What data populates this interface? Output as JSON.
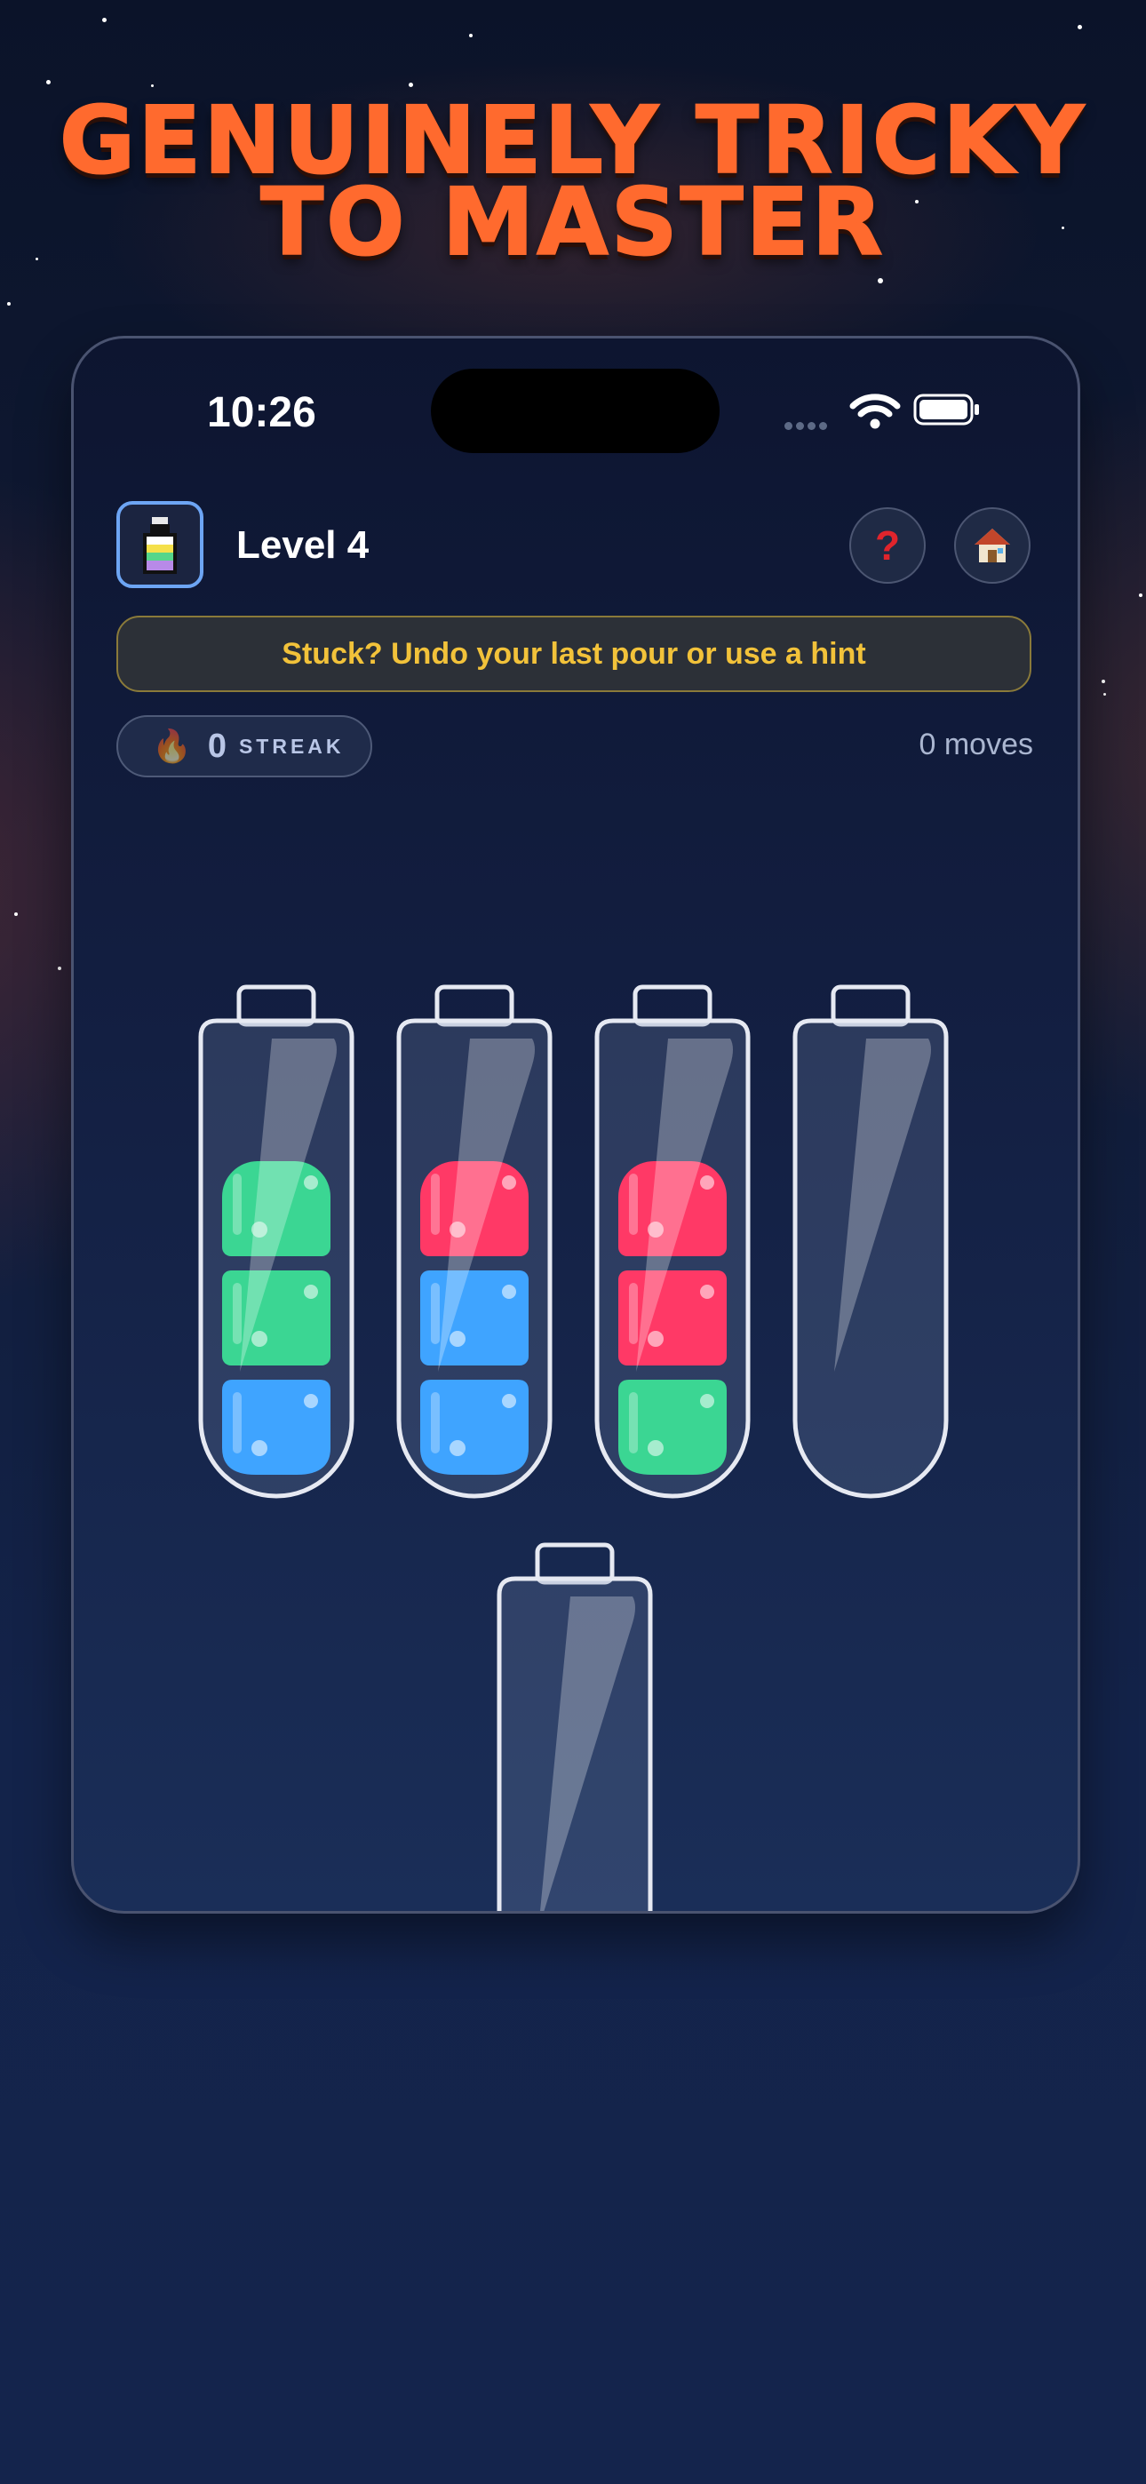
{
  "headline": {
    "line1": "GENUINELY TRICKY",
    "line2": "TO MASTER"
  },
  "status_bar": {
    "time": "10:26"
  },
  "header": {
    "level_label": "Level 4",
    "help_icon": "question-mark-icon",
    "home_icon": "house-icon"
  },
  "hint": {
    "text": "Stuck? Undo your last pour or use a hint"
  },
  "streak": {
    "value": "0",
    "label": "STREAK",
    "icon": "fire-icon"
  },
  "moves": {
    "text": "0 moves"
  },
  "colors": {
    "accent_headline": "#ff6a2e",
    "hint_text": "#f2c23a",
    "green": "#3bd693",
    "blue": "#3fa4ff",
    "red": "#ff3966"
  },
  "tubes": [
    {
      "id": "tube-1",
      "layers_bottom_to_top": [
        "blue",
        "green",
        "green"
      ]
    },
    {
      "id": "tube-2",
      "layers_bottom_to_top": [
        "blue",
        "blue",
        "red"
      ]
    },
    {
      "id": "tube-3",
      "layers_bottom_to_top": [
        "green",
        "red",
        "red"
      ]
    },
    {
      "id": "tube-4",
      "layers_bottom_to_top": []
    },
    {
      "id": "tube-5",
      "layers_bottom_to_top": []
    }
  ]
}
